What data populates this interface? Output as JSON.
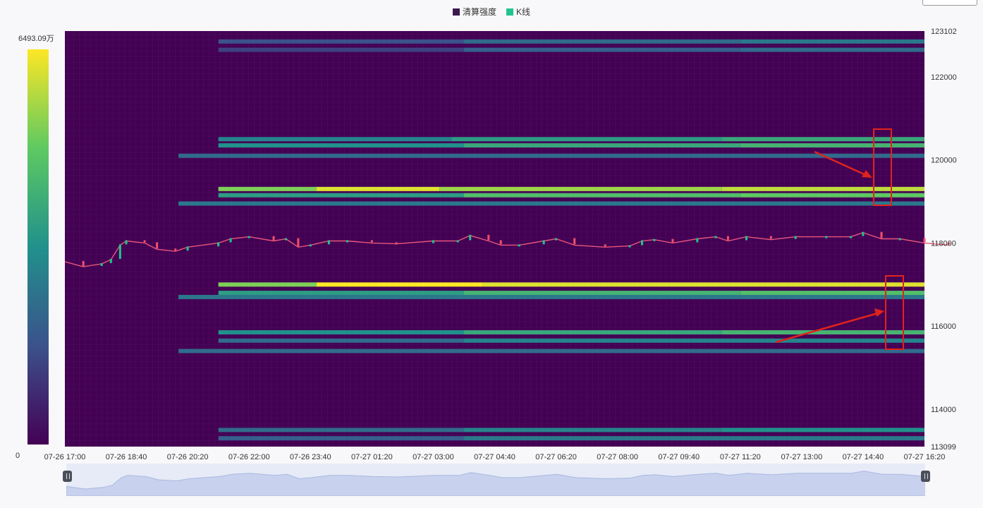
{
  "legend": [
    {
      "label": "清算强度",
      "color": "#3b1a4d"
    },
    {
      "label": "K线",
      "color": "#1fc58d"
    }
  ],
  "colorbar": {
    "max_label": "6493.09万",
    "min_label": "0",
    "low_color": "#440154",
    "high_color": "#fde725"
  },
  "chart_data": {
    "type": "heatmap",
    "series_names": [
      "清算强度",
      "K线"
    ],
    "x_ticks": [
      "07-26 17:00",
      "07-26 18:40",
      "07-26 20:20",
      "07-26 22:00",
      "07-26 23:40",
      "07-27 01:20",
      "07-27 03:00",
      "07-27 04:40",
      "07-27 06:20",
      "07-27 08:00",
      "07-27 09:40",
      "07-27 11:20",
      "07-27 13:00",
      "07-27 14:40",
      "07-27 16:20"
    ],
    "y_ticks": [
      "123102",
      "122000",
      "120000",
      "118000",
      "116000",
      "114000",
      "113099"
    ],
    "ylim": [
      113099,
      123102
    ],
    "colorbar_range": [
      0,
      6493.09
    ],
    "liquidation_bands": [
      {
        "price": 122850,
        "start": 2.5,
        "segments": [
          [
            2.5,
            0.25
          ],
          [
            6.5,
            0.35
          ],
          [
            11.0,
            0.4
          ]
        ]
      },
      {
        "price": 122650,
        "start": 2.5,
        "segments": [
          [
            2.5,
            0.2
          ],
          [
            6.5,
            0.3
          ],
          [
            11.0,
            0.35
          ]
        ]
      },
      {
        "price": 120500,
        "start": 2.5,
        "segments": [
          [
            2.5,
            0.45
          ],
          [
            6.3,
            0.55
          ],
          [
            10.7,
            0.6
          ]
        ]
      },
      {
        "price": 120350,
        "start": 2.5,
        "segments": [
          [
            2.5,
            0.5
          ],
          [
            6.5,
            0.6
          ],
          [
            11.0,
            0.65
          ]
        ]
      },
      {
        "price": 120100,
        "start": 1.85,
        "segments": [
          [
            1.85,
            0.35
          ]
        ]
      },
      {
        "price": 119300,
        "start": 2.5,
        "segments": [
          [
            2.5,
            0.8
          ],
          [
            4.1,
            0.95
          ],
          [
            6.1,
            0.85
          ],
          [
            10.7,
            0.9
          ]
        ]
      },
      {
        "price": 119150,
        "start": 2.5,
        "segments": [
          [
            2.5,
            0.55
          ],
          [
            6.5,
            0.7
          ],
          [
            11.0,
            0.75
          ]
        ]
      },
      {
        "price": 118950,
        "start": 1.85,
        "segments": [
          [
            1.85,
            0.4
          ]
        ]
      },
      {
        "price": 117000,
        "start": 2.5,
        "segments": [
          [
            2.5,
            0.8
          ],
          [
            4.1,
            1.0
          ],
          [
            6.8,
            0.95
          ]
        ]
      },
      {
        "price": 116800,
        "start": 2.5,
        "segments": [
          [
            2.5,
            0.55
          ],
          [
            6.5,
            0.65
          ],
          [
            11.0,
            0.7
          ]
        ]
      },
      {
        "price": 116700,
        "start": 1.85,
        "segments": [
          [
            1.85,
            0.4
          ]
        ]
      },
      {
        "price": 115850,
        "start": 2.5,
        "segments": [
          [
            2.5,
            0.5
          ],
          [
            6.5,
            0.6
          ],
          [
            10.7,
            0.65
          ]
        ]
      },
      {
        "price": 115650,
        "start": 2.5,
        "segments": [
          [
            2.5,
            0.35
          ],
          [
            6.5,
            0.45
          ]
        ]
      },
      {
        "price": 115400,
        "start": 1.85,
        "segments": [
          [
            1.85,
            0.35
          ]
        ]
      },
      {
        "price": 113500,
        "start": 2.5,
        "segments": [
          [
            2.5,
            0.35
          ],
          [
            6.5,
            0.45
          ],
          [
            10.7,
            0.5
          ]
        ]
      },
      {
        "price": 113300,
        "start": 2.5,
        "segments": [
          [
            2.5,
            0.3
          ],
          [
            6.5,
            0.4
          ]
        ]
      }
    ],
    "kline_path": [
      [
        0,
        117550
      ],
      [
        0.3,
        117430
      ],
      [
        0.6,
        117500
      ],
      [
        0.75,
        117600
      ],
      [
        0.9,
        117950
      ],
      [
        1.0,
        118050
      ],
      [
        1.3,
        118000
      ],
      [
        1.5,
        117850
      ],
      [
        1.8,
        117800
      ],
      [
        2.0,
        117900
      ],
      [
        2.5,
        118000
      ],
      [
        2.7,
        118100
      ],
      [
        3.0,
        118150
      ],
      [
        3.4,
        118050
      ],
      [
        3.6,
        118100
      ],
      [
        3.8,
        117900
      ],
      [
        4.0,
        117950
      ],
      [
        4.3,
        118050
      ],
      [
        4.6,
        118050
      ],
      [
        5.0,
        118000
      ],
      [
        5.4,
        117980
      ],
      [
        6.0,
        118050
      ],
      [
        6.4,
        118050
      ],
      [
        6.6,
        118180
      ],
      [
        6.9,
        118050
      ],
      [
        7.1,
        117950
      ],
      [
        7.4,
        117950
      ],
      [
        7.8,
        118050
      ],
      [
        8.0,
        118100
      ],
      [
        8.3,
        117950
      ],
      [
        8.8,
        117900
      ],
      [
        9.2,
        117930
      ],
      [
        9.4,
        118050
      ],
      [
        9.6,
        118080
      ],
      [
        9.9,
        118000
      ],
      [
        10.3,
        118100
      ],
      [
        10.6,
        118150
      ],
      [
        10.8,
        118050
      ],
      [
        11.1,
        118150
      ],
      [
        11.5,
        118080
      ],
      [
        11.9,
        118150
      ],
      [
        12.4,
        118150
      ],
      [
        12.8,
        118150
      ],
      [
        13.0,
        118250
      ],
      [
        13.3,
        118100
      ],
      [
        13.6,
        118100
      ],
      [
        14.0,
        118000
      ],
      [
        14.4,
        117950
      ]
    ]
  }
}
